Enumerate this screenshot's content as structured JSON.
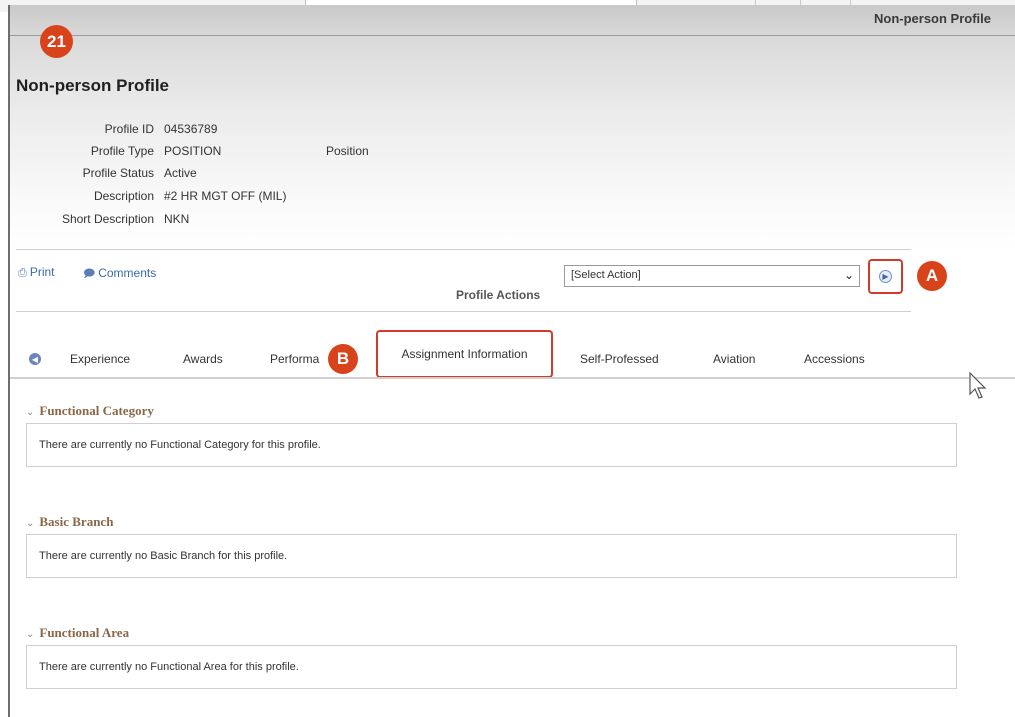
{
  "header": {
    "right_title": "Non-person Profile",
    "step_badge": "21",
    "page_title": "Non-person Profile"
  },
  "profile": {
    "rows": [
      {
        "label": "Profile ID",
        "value": "04536789",
        "extra": ""
      },
      {
        "label": "Profile Type",
        "value": "POSITION",
        "extra": "Position"
      },
      {
        "label": "Profile Status",
        "value": "Active",
        "extra": ""
      },
      {
        "label": "Description",
        "value": "#2 HR MGT OFF (MIL)",
        "extra": ""
      },
      {
        "label": "Short Description",
        "value": "NKN",
        "extra": ""
      }
    ]
  },
  "toolbar": {
    "print_label": "Print",
    "comments_label": "Comments",
    "profile_actions_label": "Profile Actions",
    "select_value": "[Select Action]"
  },
  "callouts": {
    "a": "A",
    "b": "B"
  },
  "tabs": [
    {
      "label": "Experience"
    },
    {
      "label": "Awards"
    },
    {
      "label": "Performa"
    },
    {
      "label": "Assignment Information"
    },
    {
      "label": "Self-Professed"
    },
    {
      "label": "Aviation"
    },
    {
      "label": "Accessions"
    }
  ],
  "sections": [
    {
      "title": "Functional Category",
      "message": "There are currently no Functional Category for this profile."
    },
    {
      "title": "Basic Branch",
      "message": "There are currently no Basic Branch for this profile."
    },
    {
      "title": "Functional Area",
      "message": "There are currently no Functional Area for this profile."
    }
  ],
  "colors": {
    "callout": "#d8431b",
    "highlight_border": "#d23a2a",
    "section_title": "#8a6748",
    "link": "#3a6ab0"
  },
  "icons": {
    "print": "printer-icon",
    "comments": "comment-icon",
    "go": "go-arrow-icon",
    "tab_prev": "chevron-left-icon",
    "section_toggle": "chevron-down-icon"
  }
}
